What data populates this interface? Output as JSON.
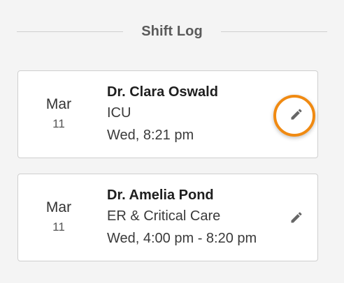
{
  "header": {
    "title": "Shift Log"
  },
  "entries": [
    {
      "month": "Mar",
      "day": "11",
      "name": "Dr. Clara Oswald",
      "department": "ICU",
      "time": "Wed, 8:21 pm",
      "edit_icon": "pencil-icon"
    },
    {
      "month": "Mar",
      "day": "11",
      "name": "Dr. Amelia Pond",
      "department": "ER & Critical Care",
      "time": "Wed, 4:00 pm - 8:20 pm",
      "edit_icon": "pencil-icon"
    }
  ],
  "colors": {
    "background": "#f4f4f4",
    "card": "#ffffff",
    "highlight": "#f08a12",
    "icon": "#666666"
  }
}
